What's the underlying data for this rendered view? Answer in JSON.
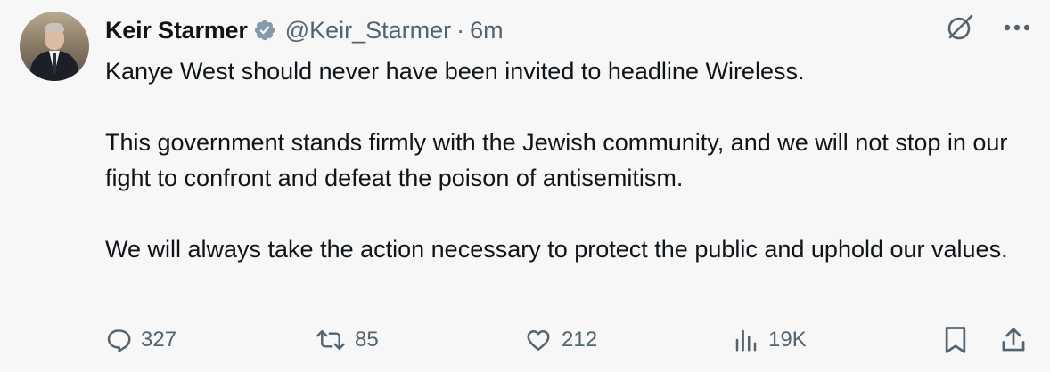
{
  "author": {
    "name": "Keir Starmer",
    "handle": "@Keir_Starmer",
    "separator": "·",
    "time": "6m"
  },
  "icons": {
    "avatar": "profile-photo",
    "verified": "verified-badge-icon",
    "grok": "grok-icon",
    "more": "more-options-icon"
  },
  "tweet": {
    "paragraphs": [
      "Kanye West should never have been invited to headline Wireless.",
      "This government stands firmly with the Jewish community, and we will not stop in our fight to confront and defeat the poison of antisemitism.",
      "We will always take the action necessary to protect the public and uphold our values."
    ]
  },
  "actions": {
    "replies": "327",
    "reposts": "85",
    "likes": "212",
    "views": "19K"
  },
  "colors": {
    "text": "#0f1419",
    "secondary": "#536471",
    "background": "#f7f7f7"
  }
}
